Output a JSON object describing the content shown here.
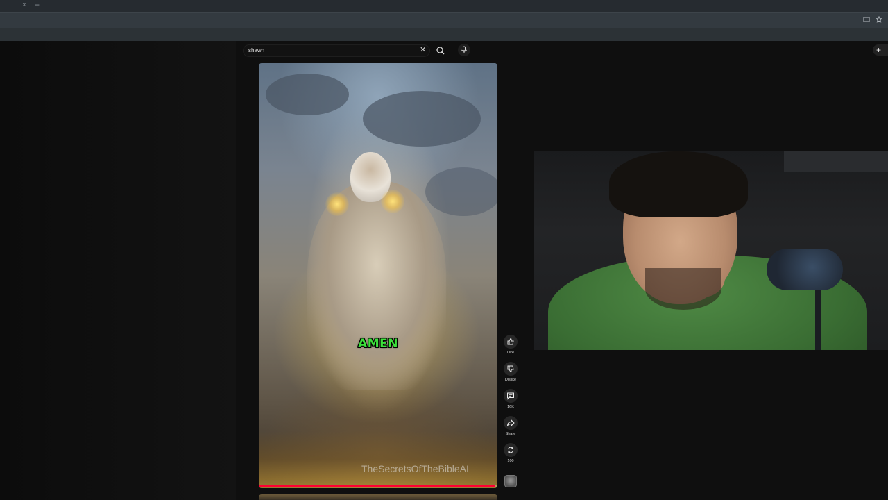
{
  "browser": {
    "tab_close": "×",
    "tab_new": "+"
  },
  "search": {
    "value": "shawn",
    "clear_glyph": "✕"
  },
  "header": {
    "create_glyph": "+"
  },
  "short": {
    "caption": "AMEN",
    "watermark": "TheSecretsOfTheBibleAI",
    "progress_fraction": 0.99
  },
  "actions": [
    {
      "id": "like",
      "label": "Like"
    },
    {
      "id": "dislike",
      "label": "Dislike"
    },
    {
      "id": "comments",
      "label": "16K"
    },
    {
      "id": "share",
      "label": "Share"
    },
    {
      "id": "remix",
      "label": "100"
    }
  ],
  "colors": {
    "caption_green": "#3ce03a",
    "progress_red": "#ff0033",
    "shirt_green": "#3a6d33"
  }
}
